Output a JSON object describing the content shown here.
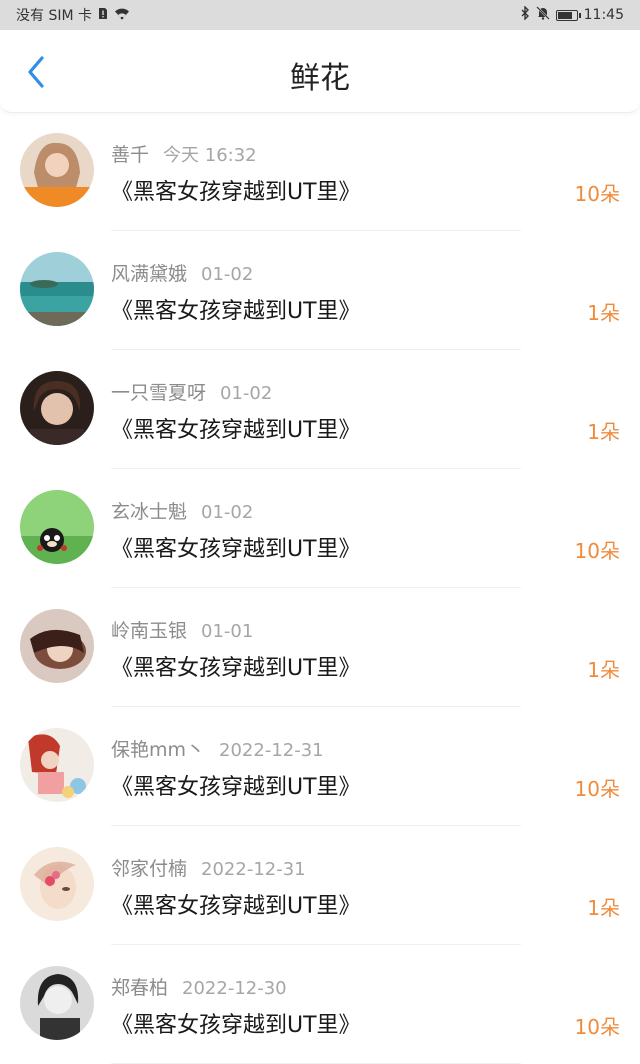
{
  "status_bar": {
    "carrier": "没有 SIM 卡",
    "time": "11:45",
    "battery_level": 0.85
  },
  "header": {
    "title": "鲜花",
    "back_icon": "chevron-left-icon",
    "accent_color": "#2f8ee8"
  },
  "count_color": "#f08b3c",
  "items": [
    {
      "name": "善千",
      "date": "今天 16:32",
      "book": "《黑客女孩穿越到UT里》",
      "count": "10朵"
    },
    {
      "name": "风满黛娥",
      "date": "01-02",
      "book": "《黑客女孩穿越到UT里》",
      "count": "1朵"
    },
    {
      "name": "一只雪夏呀",
      "date": "01-02",
      "book": "《黑客女孩穿越到UT里》",
      "count": "1朵"
    },
    {
      "name": "玄冰士魁",
      "date": "01-02",
      "book": "《黑客女孩穿越到UT里》",
      "count": "10朵"
    },
    {
      "name": "岭南玉银",
      "date": "01-01",
      "book": "《黑客女孩穿越到UT里》",
      "count": "1朵"
    },
    {
      "name": "保艳mm丶",
      "date": "2022-12-31",
      "book": "《黑客女孩穿越到UT里》",
      "count": "10朵"
    },
    {
      "name": "邻家付楠",
      "date": "2022-12-31",
      "book": "《黑客女孩穿越到UT里》",
      "count": "1朵"
    },
    {
      "name": "郑春柏",
      "date": "2022-12-30",
      "book": "《黑客女孩穿越到UT里》",
      "count": "10朵"
    }
  ]
}
